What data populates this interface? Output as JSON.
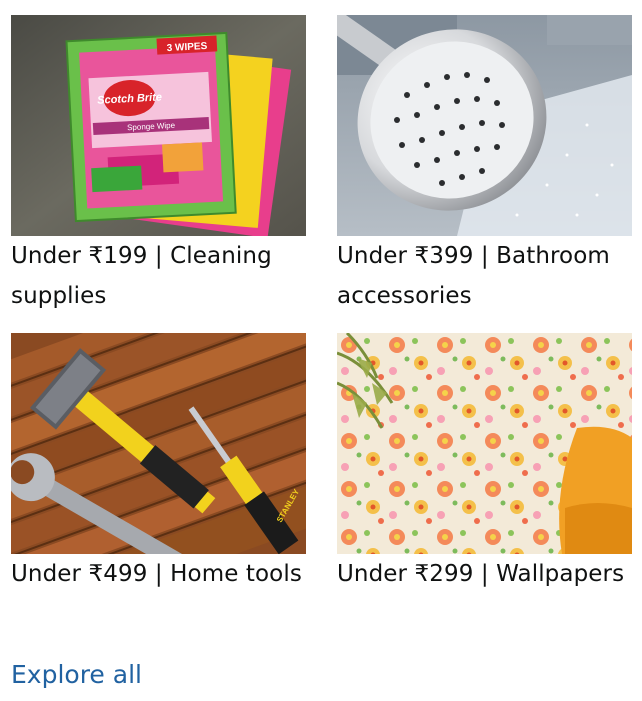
{
  "cards": [
    {
      "caption": "Under ₹199 | Cleaning supplies",
      "image": "scotch-brite-sponge-wipes",
      "pack_label": "3 WIPES",
      "brand": "Scotch Brite",
      "product": "Sponge Wipe"
    },
    {
      "caption": "Under ₹399 | Bathroom accessories",
      "image": "shower-head"
    },
    {
      "caption": "Under ₹499 | Home tools",
      "image": "hammer-wrench-screwdriver",
      "brand": "STANLEY"
    },
    {
      "caption": "Under ₹299 | Wallpapers",
      "image": "floral-wallpaper"
    }
  ],
  "explore_link": "Explore all",
  "colors": {
    "link": "#2162a1",
    "text": "#0f1111"
  }
}
